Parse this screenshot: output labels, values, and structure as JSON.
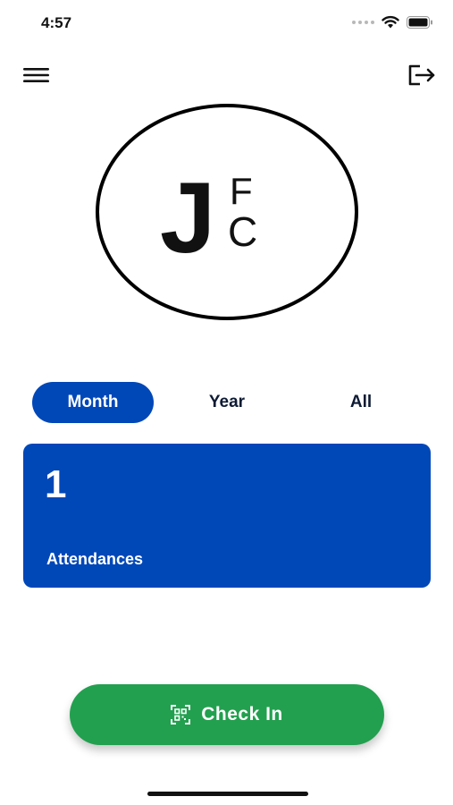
{
  "status_bar": {
    "time": "4:57",
    "icons": [
      "cellular-signal-icon",
      "wifi-icon",
      "battery-icon"
    ]
  },
  "top_bar": {
    "menu_icon": "hamburger-menu-icon",
    "logout_icon": "logout-icon"
  },
  "logo": {
    "letters": [
      "J",
      "F",
      "C"
    ]
  },
  "period_tabs": {
    "items": [
      {
        "label": "Month",
        "active": true
      },
      {
        "label": "Year",
        "active": false
      },
      {
        "label": "All",
        "active": false
      }
    ]
  },
  "stats": {
    "value": "1",
    "label": "Attendances"
  },
  "check_in": {
    "label": "Check In",
    "icon": "qr-scan-icon"
  },
  "colors": {
    "primary_blue": "#0047b8",
    "check_in_green": "#22a04f",
    "text_dark": "#0d1b34"
  }
}
